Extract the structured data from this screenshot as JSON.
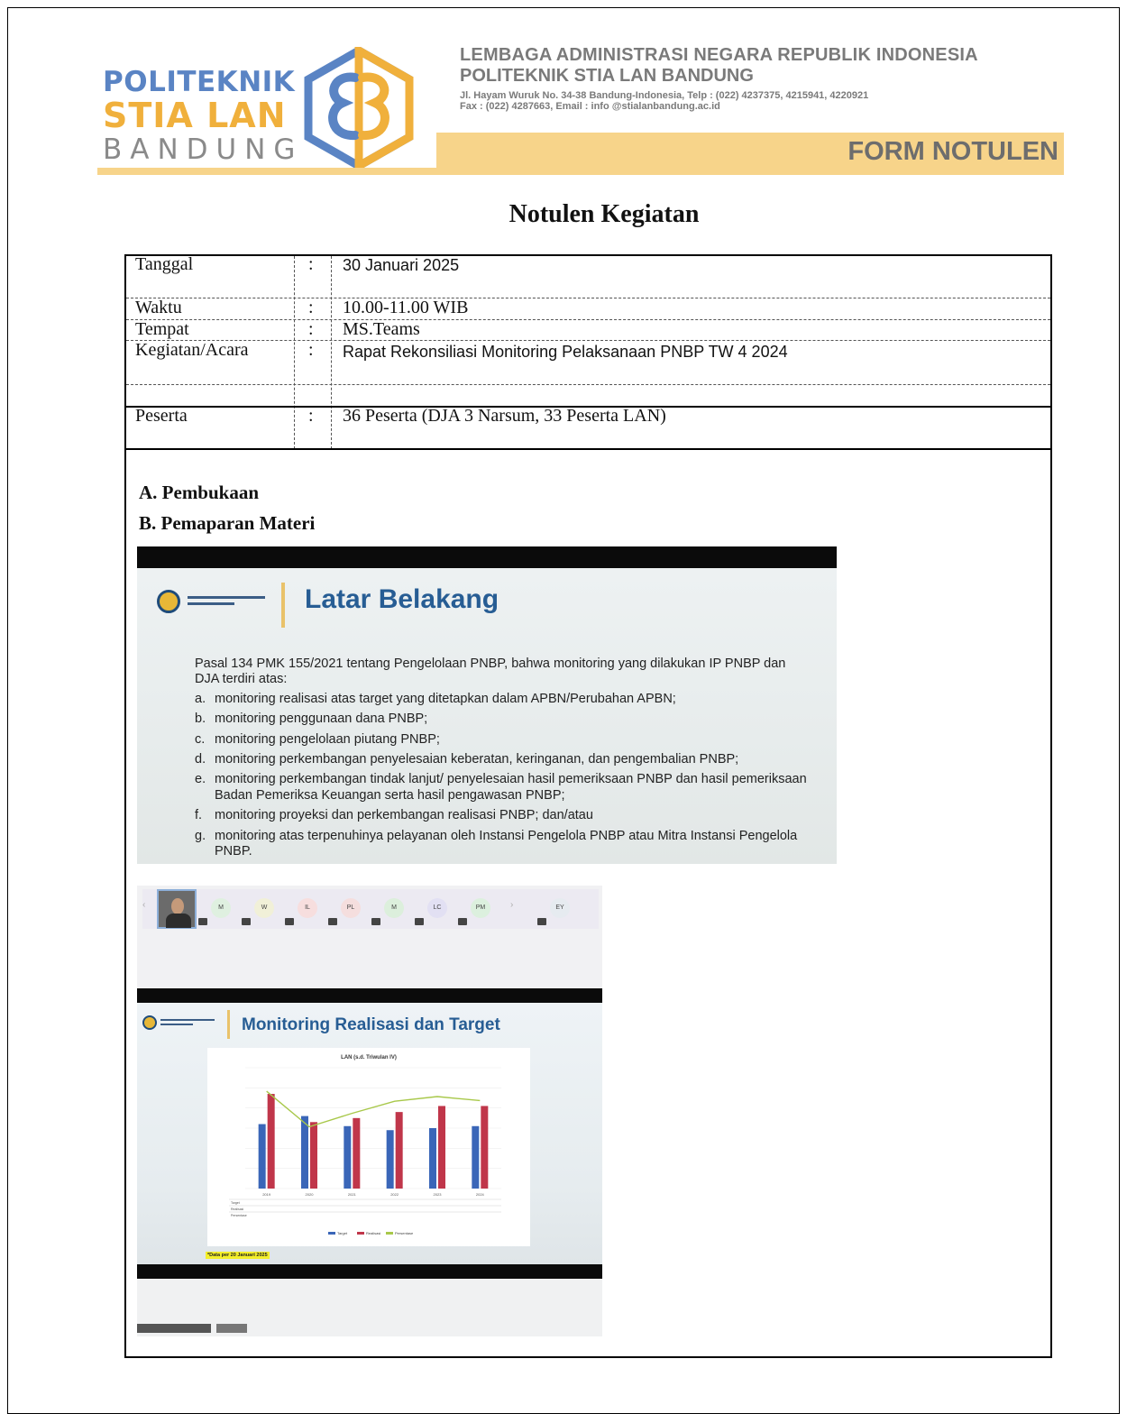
{
  "header": {
    "logo_line1": "POLITEKNIK",
    "logo_line2": "STIA LAN",
    "logo_line3": "BANDUNG",
    "institution_line1": "LEMBAGA ADMINISTRASI NEGARA REPUBLIK INDONESIA",
    "institution_line2": "POLITEKNIK STIA LAN BANDUNG",
    "address": "Jl. Hayam Wuruk No. 34-38 Bandung-Indonesia, Telp : (022) 4237375, 4215941, 4220921",
    "fax_email": "Fax : (022) 4287663, Email : info @stialanbandung.ac.id",
    "form_title": "FORM NOTULEN",
    "brand_blue": "#5a84c4",
    "brand_gold": "#f0b03c",
    "band_color": "#f7d48a"
  },
  "document_title": "Notulen Kegiatan",
  "info": {
    "colon": ":",
    "rows": [
      {
        "label": "Tanggal",
        "value": "30 Januari 2025"
      },
      {
        "label": "Waktu",
        "value": "10.00-11.00 WIB"
      },
      {
        "label": "Tempat",
        "value": "MS.Teams"
      },
      {
        "label": "Kegiatan/Acara",
        "value": "Rapat Rekonsiliasi Monitoring Pelaksanaan PNBP TW 4 2024"
      },
      {
        "label": "Peserta",
        "value": "36 Peserta (DJA 3 Narsum, 33 Peserta LAN)"
      }
    ]
  },
  "sections": [
    {
      "label": "A.  Pembukaan"
    },
    {
      "label": "B.  Pemaparan Materi"
    }
  ],
  "slide1": {
    "title": "Latar Belakang",
    "intro": "Pasal 134 PMK 155/2021 tentang Pengelolaan PNBP, bahwa monitoring yang dilakukan IP PNBP dan DJA terdiri atas:",
    "items": [
      {
        "letter": "a.",
        "text": "monitoring realisasi atas target yang ditetapkan dalam APBN/Perubahan APBN;"
      },
      {
        "letter": "b.",
        "text": "monitoring penggunaan dana PNBP;"
      },
      {
        "letter": "c.",
        "text": "monitoring pengelolaan piutang PNBP;"
      },
      {
        "letter": "d.",
        "text": "monitoring perkembangan penyelesaian keberatan, keringanan, dan pengembalian PNBP;"
      },
      {
        "letter": "e.",
        "text": "monitoring perkembangan tindak lanjut/ penyelesaian hasil pemeriksaan PNBP dan hasil pemeriksaan Badan Pemeriksa Keuangan serta hasil pengawasan PNBP;"
      },
      {
        "letter": "f.",
        "text": "monitoring proyeksi dan perkembangan realisasi PNBP; dan/atau"
      },
      {
        "letter": "g.",
        "text": "monitoring atas terpenuhinya pelayanan oleh Instansi Pengelola PNBP atau Mitra Instansi Pengelola PNBP."
      }
    ]
  },
  "participants": [
    {
      "initials": "M",
      "color": "#dff0e0"
    },
    {
      "initials": "W",
      "color": "#f1f0d8"
    },
    {
      "initials": "IL",
      "color": "#f7dede"
    },
    {
      "initials": "PL",
      "color": "#f5dede"
    },
    {
      "initials": "M",
      "color": "#dcefdc"
    },
    {
      "initials": "LC",
      "color": "#e2e0f3"
    },
    {
      "initials": "PM",
      "color": "#dcf0de"
    },
    {
      "initials": "EY",
      "color": "#e6ebf0"
    }
  ],
  "slide2": {
    "title": "Monitoring Realisasi dan Target",
    "data_note": "*Data per 20 Januari 2025"
  },
  "chart_data": {
    "type": "bar",
    "title": "LAN (s.d. Triwulan IV)",
    "categories": [
      "2019",
      "2020",
      "2021",
      "2022",
      "2023",
      "2024"
    ],
    "series": [
      {
        "name": "Target",
        "kind": "bar",
        "color": "#3a66b8",
        "values": [
          32,
          36,
          31,
          29,
          30,
          31
        ]
      },
      {
        "name": "Realisasi",
        "kind": "bar",
        "color": "#c0364a",
        "values": [
          47,
          33,
          35,
          38,
          41,
          41
        ]
      },
      {
        "name": "Persentase",
        "kind": "line",
        "color": "#a8c84a",
        "values": [
          145,
          92,
          112,
          130,
          137,
          131
        ]
      }
    ],
    "ylim": [
      0,
      60
    ],
    "y2lim": [
      0,
      180
    ],
    "legend": "bottom"
  }
}
